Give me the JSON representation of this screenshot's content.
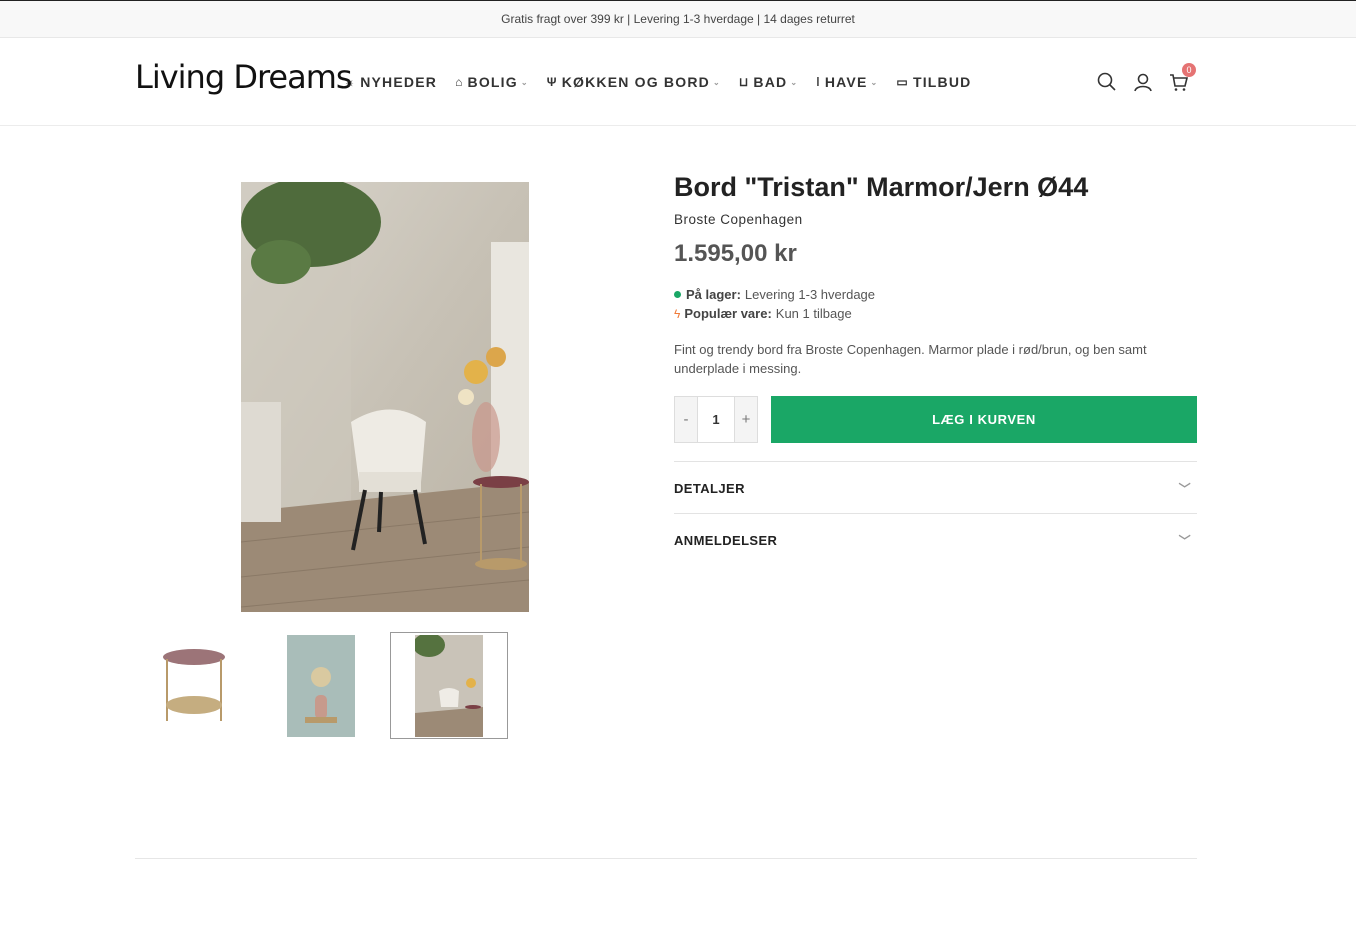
{
  "topbar": {
    "text": "Gratis fragt over 399 kr | Levering 1-3 hverdage | 14 dages returret"
  },
  "header": {
    "logo": "Living Dreams",
    "nav": [
      {
        "label": "NYHEDER",
        "icon": "sun-icon",
        "dropdown": false
      },
      {
        "label": "BOLIG",
        "icon": "home-icon",
        "dropdown": true
      },
      {
        "label": "KØKKEN OG BORD",
        "icon": "utensils-icon",
        "dropdown": true
      },
      {
        "label": "BAD",
        "icon": "bathtub-icon",
        "dropdown": true
      },
      {
        "label": "HAVE",
        "icon": "thermometer-icon",
        "dropdown": true
      },
      {
        "label": "TILBUD",
        "icon": "credit-card-icon",
        "dropdown": false
      }
    ],
    "cart_count": "0"
  },
  "product": {
    "title": "Bord \"Tristan\" Marmor/Jern Ø44",
    "brand": "Broste Copenhagen",
    "price": "1.595,00 kr",
    "stock_label": "På lager:",
    "stock_value": "Levering 1-3 hverdage",
    "popular_label": "Populær vare:",
    "popular_value": "Kun 1 tilbage",
    "description": "Fint og trendy bord fra Broste Copenhagen. Marmor plade i rød/brun, og ben samt underplade i messing.",
    "quantity": "1",
    "minus": "-",
    "plus": "+",
    "add_to_cart": "LÆG I KURVEN"
  },
  "accordions": [
    {
      "label": "DETALJER"
    },
    {
      "label": "ANMELDELSER"
    }
  ],
  "colors": {
    "accent": "#1aa766",
    "badge": "#e57373",
    "bolt": "#f07b3a"
  }
}
